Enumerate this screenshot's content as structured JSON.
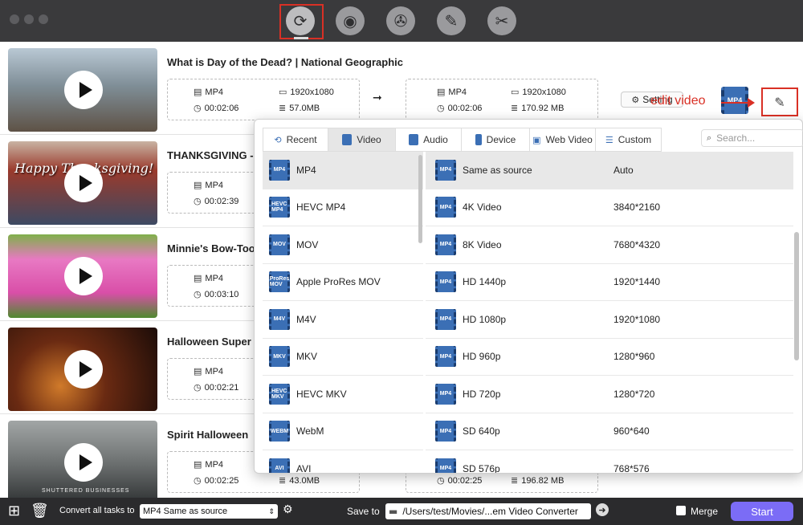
{
  "toolbar": {
    "icons": [
      "convert-icon",
      "rip-dvd-icon",
      "video-film-icon",
      "video-edit-icon",
      "video-tools-icon"
    ]
  },
  "videos": [
    {
      "title": "What is Day of the Dead? | National Geographic",
      "src_format": "MP4",
      "src_duration": "00:02:06",
      "src_resolution": "1920x1080",
      "src_size": "57.0MB",
      "dst_format": "MP4",
      "dst_duration": "00:02:06",
      "dst_resolution": "1920x1080",
      "dst_size": "170.92 MB",
      "setting_label": "Setting",
      "format_badge": "MP4",
      "thumb_colors": [
        "#8fa7b8",
        "#6b5d4f"
      ]
    },
    {
      "title": "THANKSGIVING -",
      "src_format": "MP4",
      "src_duration": "00:02:39",
      "thumb_text": "Happy Thanksgiving!",
      "thumb_colors": [
        "#a33b2c",
        "#2f3f5a"
      ]
    },
    {
      "title": "Minnie's Bow-Too",
      "src_format": "MP4",
      "src_duration": "00:03:10",
      "thumb_colors": [
        "#e46bb5",
        "#6aa84f"
      ]
    },
    {
      "title": "Halloween Super",
      "src_format": "MP4",
      "src_duration": "00:02:21",
      "thumb_colors": [
        "#3a1a10",
        "#a3521c"
      ]
    },
    {
      "title": "Spirit Halloween",
      "src_format": "MP4",
      "src_duration": "00:02:25",
      "src_size": "43.0MB",
      "dst_duration": "00:02:25",
      "dst_size": "196.82 MB",
      "thumb_text": "SHUTTERED BUSINESSES",
      "thumb_colors": [
        "#7d8080",
        "#3c3f40"
      ]
    }
  ],
  "annotation": {
    "edit_label": "edit video"
  },
  "popup": {
    "tabs": [
      {
        "label": "Recent",
        "icon": "recent-icon"
      },
      {
        "label": "Video",
        "icon": "video-icon",
        "active": true
      },
      {
        "label": "Audio",
        "icon": "audio-icon"
      },
      {
        "label": "Device",
        "icon": "device-icon"
      },
      {
        "label": "Web Video",
        "icon": "web-video-icon"
      },
      {
        "label": "Custom",
        "icon": "custom-icon"
      }
    ],
    "search_placeholder": "Search...",
    "formats": [
      {
        "label": "MP4",
        "badge": "MP4",
        "selected": true
      },
      {
        "label": "HEVC MP4",
        "badge": "HEVC MP4"
      },
      {
        "label": "MOV",
        "badge": "MOV"
      },
      {
        "label": "Apple ProRes MOV",
        "badge": "ProRes MOV"
      },
      {
        "label": "M4V",
        "badge": "M4V"
      },
      {
        "label": "MKV",
        "badge": "MKV"
      },
      {
        "label": "HEVC MKV",
        "badge": "HEVC MKV"
      },
      {
        "label": "WebM",
        "badge": "WEBM"
      },
      {
        "label": "AVI",
        "badge": "AVI"
      }
    ],
    "resolutions": [
      {
        "name": "Same as source",
        "value": "Auto",
        "selected": true
      },
      {
        "name": "4K Video",
        "value": "3840*2160"
      },
      {
        "name": "8K Video",
        "value": "7680*4320"
      },
      {
        "name": "HD 1440p",
        "value": "1920*1440"
      },
      {
        "name": "HD 1080p",
        "value": "1920*1080"
      },
      {
        "name": "HD 960p",
        "value": "1280*960"
      },
      {
        "name": "HD 720p",
        "value": "1280*720"
      },
      {
        "name": "SD 640p",
        "value": "960*640"
      },
      {
        "name": "SD 576p",
        "value": "768*576"
      }
    ]
  },
  "bottom": {
    "convert_all_label": "Convert all tasks to",
    "convert_all_value": "MP4 Same as source",
    "save_to_label": "Save to",
    "save_path": "/Users/test/Movies/...em Video Converter",
    "merge_label": "Merge",
    "start_label": "Start"
  }
}
